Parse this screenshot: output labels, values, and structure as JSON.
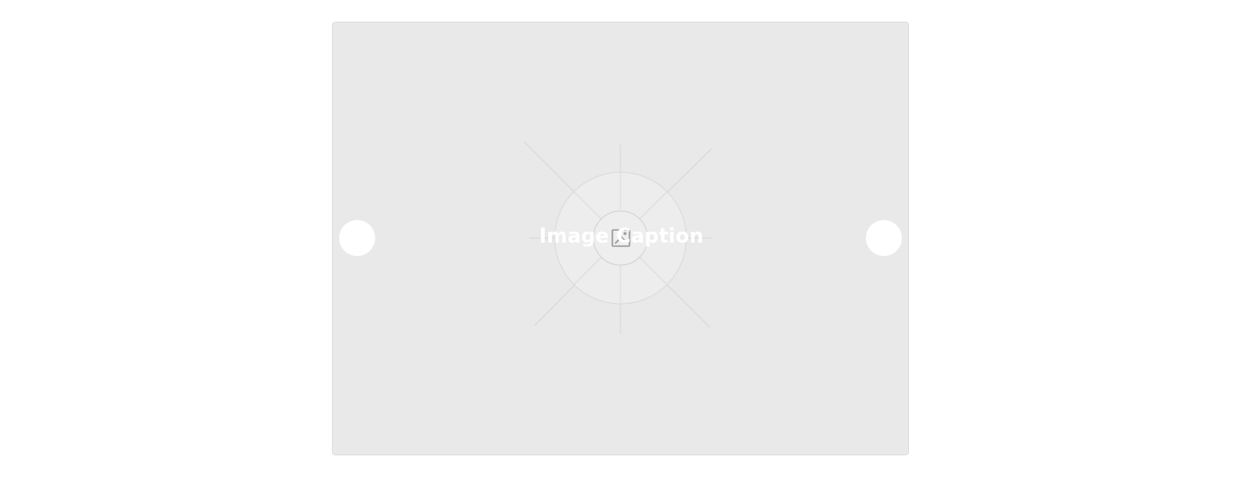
{
  "carousel": {
    "caption": "Image Caption",
    "background_color": "#e9e9e9",
    "caption_color": "#ffffff",
    "placeholder_icon": "image-placeholder-icon",
    "prev_icon": "chevron-left-icon",
    "next_icon": "chevron-right-icon"
  }
}
